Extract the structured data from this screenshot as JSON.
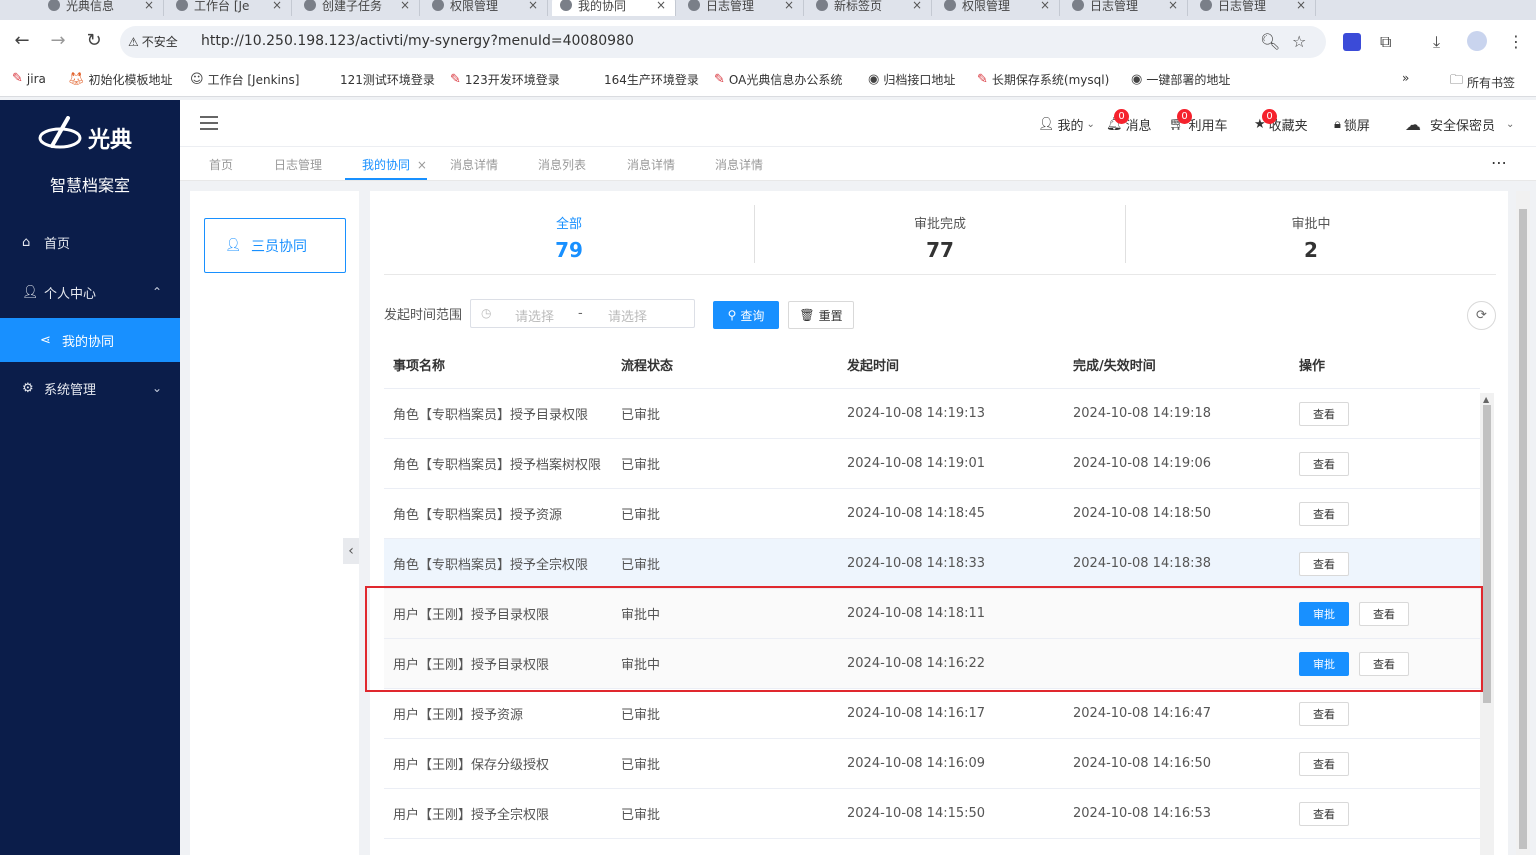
{
  "browser": {
    "tabs": [
      {
        "label": "光典信息"
      },
      {
        "label": "工作台 [Je"
      },
      {
        "label": "创建子任务"
      },
      {
        "label": "权限管理"
      },
      {
        "label": "我的协同",
        "active": true
      },
      {
        "label": "日志管理"
      },
      {
        "label": "新标签页"
      },
      {
        "label": "权限管理"
      },
      {
        "label": "日志管理"
      },
      {
        "label": "日志管理"
      }
    ],
    "security_label": "不安全",
    "url": "http://10.250.198.123/activti/my-synergy?menuId=40080980",
    "bookmarks": [
      {
        "label": "jira"
      },
      {
        "label": "初始化模板地址"
      },
      {
        "label": "工作台 [Jenkins]"
      },
      {
        "label": "121测试环境登录"
      },
      {
        "label": "123开发环境登录"
      },
      {
        "label": "164生产环境登录"
      },
      {
        "label": "OA光典信息办公系统"
      },
      {
        "label": "归档接口地址"
      },
      {
        "label": "长期保存系统(mysql)"
      },
      {
        "label": "一键部署的地址"
      }
    ],
    "bookmarks_more": "»",
    "all_bookmarks": "所有书签"
  },
  "sidebar": {
    "logo_text": "光典",
    "system_name": "智慧档案室",
    "items": [
      {
        "label": "首页",
        "icon": "home-icon"
      },
      {
        "label": "个人中心",
        "icon": "user-icon",
        "arrow": "⌃"
      },
      {
        "label": "我的协同",
        "icon": "share-icon",
        "active": true
      },
      {
        "label": "系统管理",
        "icon": "gear-icon",
        "arrow": "⌄"
      }
    ]
  },
  "header": {
    "my": "我的",
    "messages": "消息",
    "messages_badge": "0",
    "cart": "利用车",
    "cart_badge": "0",
    "favorites": "收藏夹",
    "favorites_badge": "0",
    "lock": "锁屏",
    "user": "安全保密员"
  },
  "page_tabs": [
    {
      "label": "首页"
    },
    {
      "label": "日志管理"
    },
    {
      "label": "我的协同",
      "active": true,
      "close": "×"
    },
    {
      "label": "消息详情"
    },
    {
      "label": "消息列表"
    },
    {
      "label": "消息详情"
    },
    {
      "label": "消息详情"
    }
  ],
  "left_panel": {
    "role_label": "三员协同"
  },
  "stats": [
    {
      "label": "全部",
      "value": "79",
      "active": true
    },
    {
      "label": "审批完成",
      "value": "77"
    },
    {
      "label": "审批中",
      "value": "2"
    }
  ],
  "filter": {
    "label": "发起时间范围",
    "start_placeholder": "请选择",
    "separator": "-",
    "end_placeholder": "请选择",
    "query": "查询",
    "reset": "重置"
  },
  "table": {
    "headers": [
      "事项名称",
      "流程状态",
      "发起时间",
      "完成/失效时间",
      "操作"
    ],
    "view_label": "查看",
    "approve_label": "审批",
    "rows": [
      {
        "name": "角色【专职档案员】授予目录权限",
        "status": "已审批",
        "start": "2024-10-08 14:19:13",
        "end": "2024-10-08 14:19:18"
      },
      {
        "name": "角色【专职档案员】授予档案树权限",
        "status": "已审批",
        "start": "2024-10-08 14:19:01",
        "end": "2024-10-08 14:19:06"
      },
      {
        "name": "角色【专职档案员】授予资源",
        "status": "已审批",
        "start": "2024-10-08 14:18:45",
        "end": "2024-10-08 14:18:50"
      },
      {
        "name": "角色【专职档案员】授予全宗权限",
        "status": "已审批",
        "start": "2024-10-08 14:18:33",
        "end": "2024-10-08 14:18:38"
      },
      {
        "name": "用户【王刚】授予目录权限",
        "status": "审批中",
        "start": "2024-10-08 14:18:11",
        "end": ""
      },
      {
        "name": "用户【王刚】授予目录权限",
        "status": "审批中",
        "start": "2024-10-08 14:16:22",
        "end": ""
      },
      {
        "name": "用户【王刚】授予资源",
        "status": "已审批",
        "start": "2024-10-08 14:16:17",
        "end": "2024-10-08 14:16:47"
      },
      {
        "name": "用户【王刚】保存分级授权",
        "status": "已审批",
        "start": "2024-10-08 14:16:09",
        "end": "2024-10-08 14:16:50"
      },
      {
        "name": "用户【王刚】授予全宗权限",
        "status": "已审批",
        "start": "2024-10-08 14:15:50",
        "end": "2024-10-08 14:16:53"
      }
    ]
  },
  "colors": {
    "primary": "#1890ff",
    "sidebar": "#0b1d4a",
    "highlight": "#e0282e"
  }
}
